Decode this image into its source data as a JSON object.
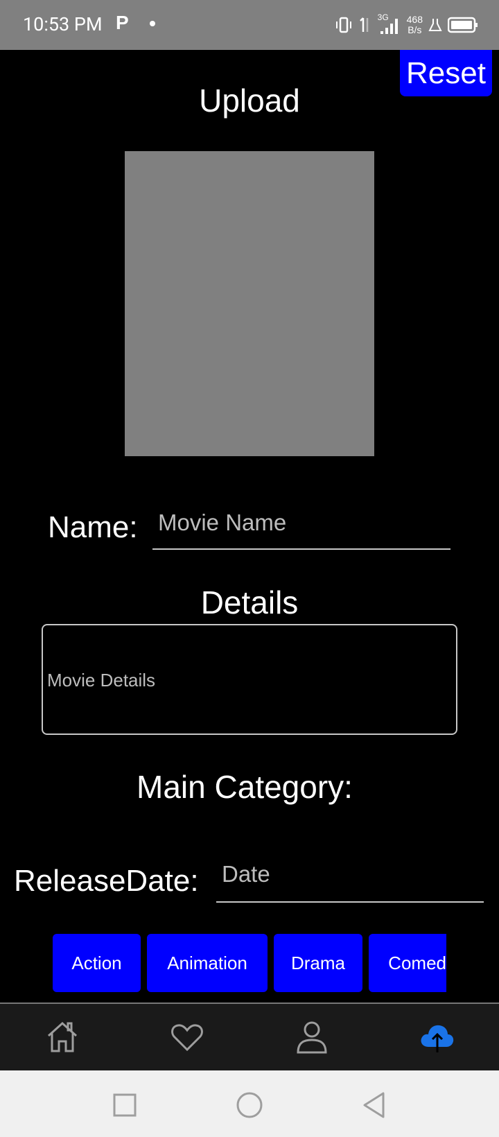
{
  "status_bar": {
    "time": "10:53 PM",
    "app_icon": "P",
    "network": "3G",
    "speed_value": "468",
    "speed_unit": "B/s"
  },
  "header": {
    "reset_label": "Reset",
    "title": "Upload"
  },
  "form": {
    "name_label": "Name:",
    "name_placeholder": "Movie Name",
    "details_label": "Details",
    "details_placeholder": "Movie Details",
    "main_category_label": "Main Category:",
    "release_date_label": "ReleaseDate:",
    "date_placeholder": "Date"
  },
  "categories": [
    "Action",
    "Animation",
    "Drama",
    "Comed"
  ],
  "bottom_nav": {
    "items": [
      "home-icon",
      "heart-icon",
      "profile-icon",
      "upload-cloud-icon"
    ],
    "active": "upload-cloud-icon",
    "active_color": "#1a73e8",
    "inactive_color": "#9e9e9e"
  },
  "colors": {
    "accent": "#0000ff",
    "background": "#000000",
    "poster_placeholder": "#808080"
  }
}
